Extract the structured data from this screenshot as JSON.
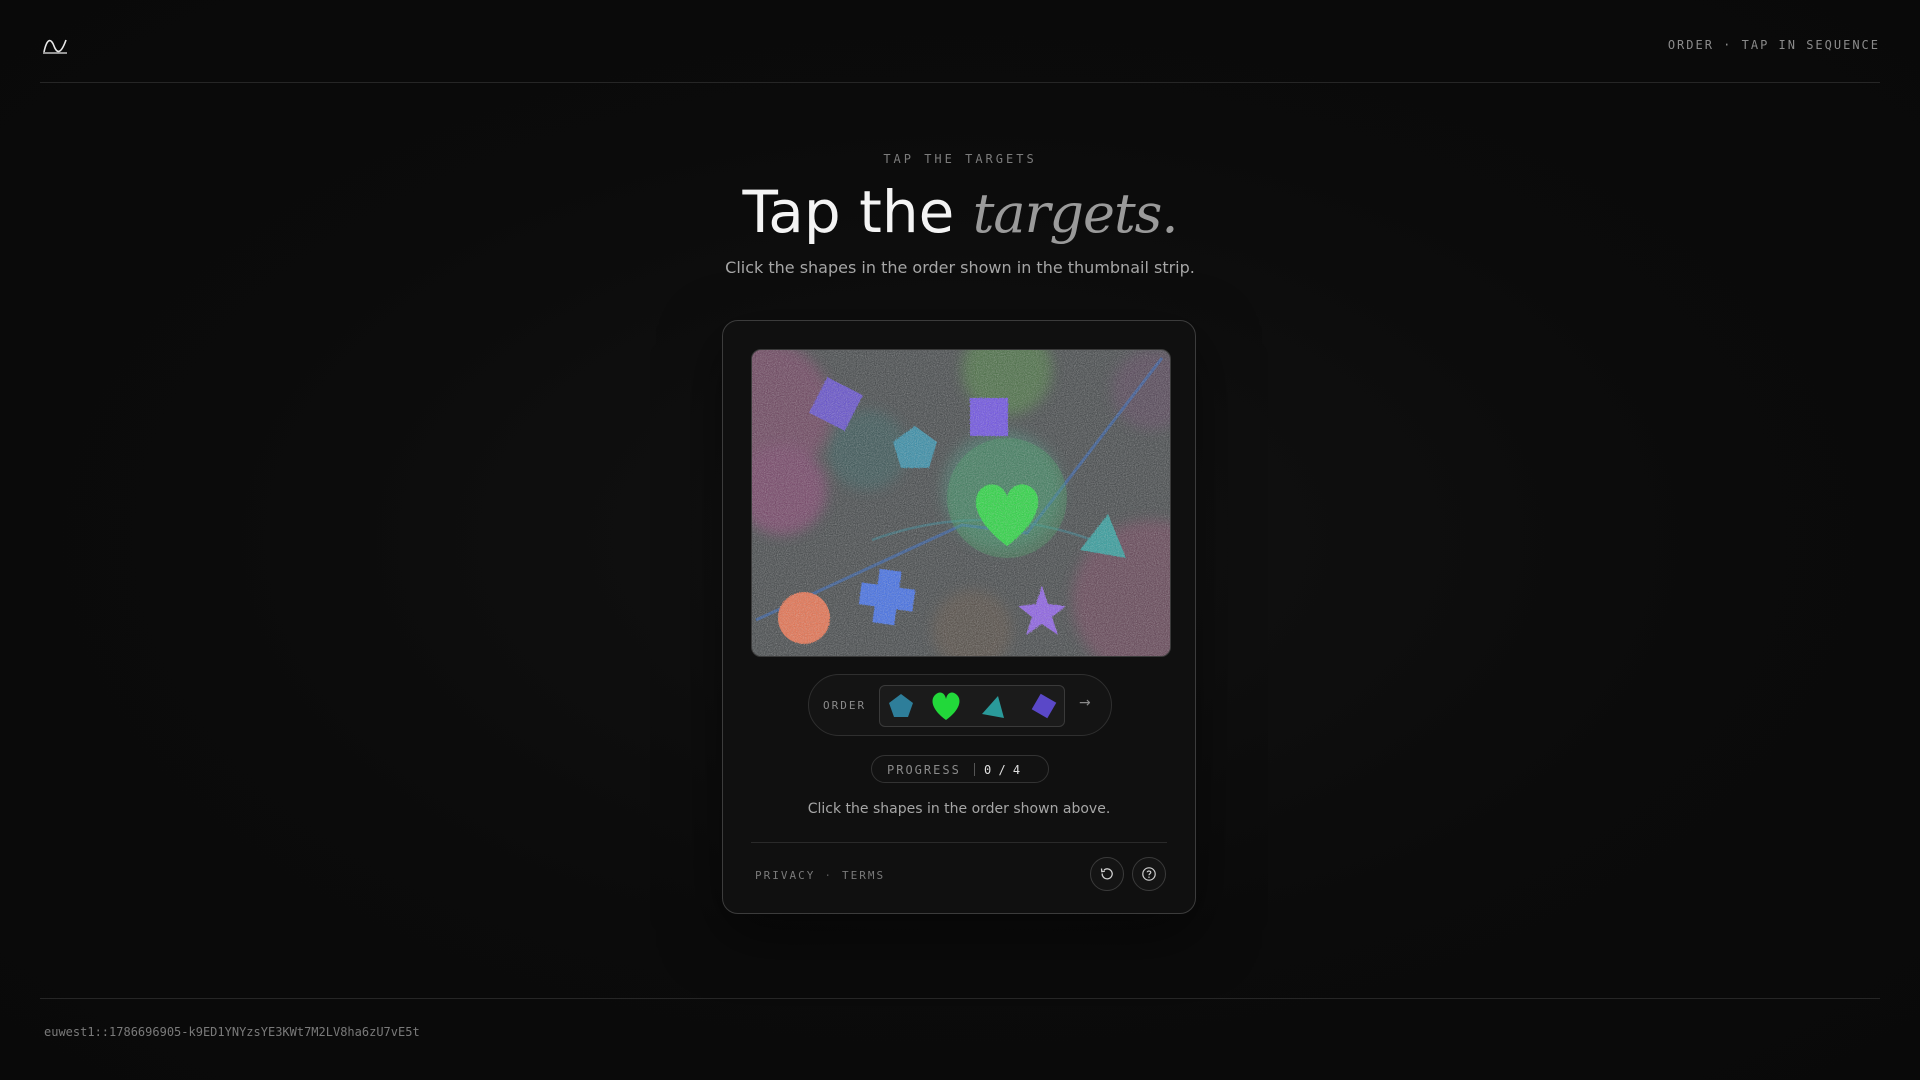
{
  "header": {
    "logo_icon": "waveform-logo-icon",
    "mode_label": "ORDER · TAP IN SEQUENCE"
  },
  "hero": {
    "eyebrow": "TAP THE TARGETS",
    "title_plain": "Tap the",
    "title_emphasis": "targets.",
    "subtitle": "Click the shapes in the order shown in the thumbnail strip."
  },
  "challenge": {
    "canvas_shapes": [
      "diamond",
      "square",
      "pentagon",
      "heart",
      "triangle",
      "circle",
      "cross",
      "star"
    ],
    "order": {
      "label": "ORDER",
      "sequence": [
        "pentagon",
        "heart",
        "triangle",
        "diamond"
      ],
      "next_icon": "arrow-right-icon"
    },
    "progress": {
      "label": "PROGRESS",
      "current": 0,
      "total": 4,
      "value_text": "0 / 4"
    },
    "instruction": "Click the shapes in the order shown above.",
    "links": {
      "privacy": "PRIVACY",
      "terms": "TERMS"
    },
    "buttons": {
      "refresh_icon": "refresh-icon",
      "help_icon": "help-icon"
    }
  },
  "colors": {
    "background": "#0b0b0b",
    "pentagon": "#2e7e9a",
    "heart": "#22d83a",
    "triangle": "#2a9a9a",
    "diamond": "#5a48c8",
    "square": "#6a4ae8",
    "circle": "#e86a4a",
    "cross": "#3a6ae8",
    "star": "#8a5ae8"
  },
  "footer": {
    "session_id": "euwest1::1786696905-k9ED1YNYzsYE3KWt7M2LV8ha6zU7vE5t"
  }
}
